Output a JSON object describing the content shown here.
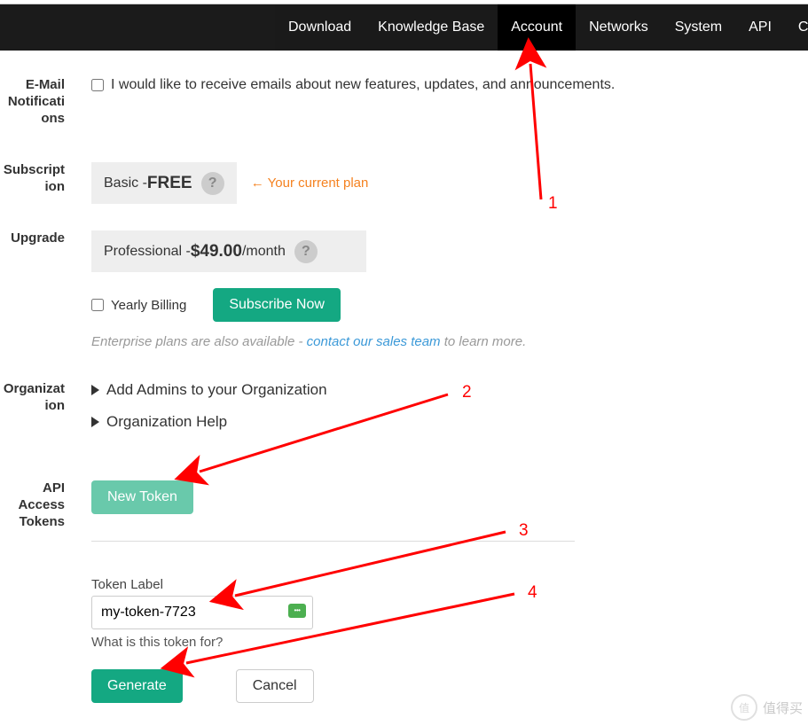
{
  "nav": {
    "items": [
      "Download",
      "Knowledge Base",
      "Account",
      "Networks",
      "System",
      "API",
      "C"
    ],
    "active_index": 2
  },
  "sections": {
    "email_notifications": {
      "label": "E-Mail Notifications",
      "checkbox_text": "I would like to receive emails about new features, updates, and announcements."
    },
    "subscription": {
      "label": "Subscription",
      "plan_prefix": "Basic - ",
      "plan_name": "FREE",
      "help": "?",
      "current_plan_arrow": "←",
      "current_plan_text": "Your current plan"
    },
    "upgrade": {
      "label": "Upgrade",
      "plan_prefix": "Professional - ",
      "price": "$49.00",
      "per": "/month",
      "help": "?",
      "yearly_label": "Yearly Billing",
      "subscribe_btn": "Subscribe Now",
      "enterprise_prefix": "Enterprise plans are also available - ",
      "enterprise_link": "contact our sales team",
      "enterprise_suffix": " to learn more."
    },
    "organization": {
      "label": "Organization",
      "add_admins": "Add Admins to your Organization",
      "org_help": "Organization Help"
    },
    "api_tokens": {
      "label": "API Access Tokens",
      "new_token_btn": "New Token",
      "field_label": "Token Label",
      "field_value": "my-token-7723",
      "help_text": "What is this token for?",
      "generate_btn": "Generate",
      "cancel_btn": "Cancel"
    }
  },
  "annotations": {
    "n1": "1",
    "n2": "2",
    "n3": "3",
    "n4": "4"
  },
  "watermark": "值得买"
}
